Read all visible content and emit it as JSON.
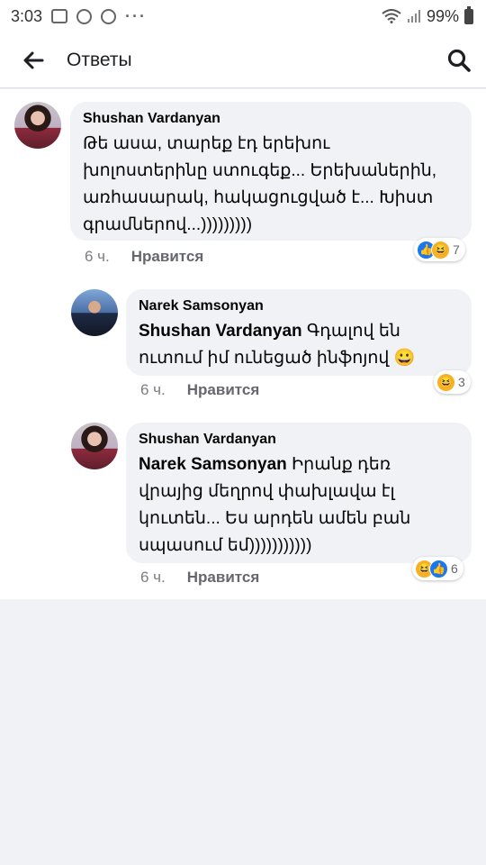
{
  "status_bar": {
    "time": "3:03",
    "dots": "···",
    "battery": "99%"
  },
  "header": {
    "title": "Ответы"
  },
  "comments": [
    {
      "author": "Shushan Vardanyan",
      "mention": "",
      "text": "Թե ասա, տարեք էդ երեխու խոլոստերինը ստուգեք... Երեխաներին, առհասարակ, հակացուցված է... Խիստ գրամներով...)))))))))",
      "time": "6 ч.",
      "like": "Нравится",
      "reaction_count": "7",
      "reaction_icons": [
        "like-icon",
        "haha-icon"
      ]
    },
    {
      "author": "Narek Samsonyan",
      "mention": "Shushan Vardanyan",
      "text": "Գդալով են ուտում իմ ունեցած ինֆոյով 😀",
      "time": "6 ч.",
      "like": "Нравится",
      "reaction_count": "3",
      "reaction_icons": [
        "haha-icon"
      ]
    },
    {
      "author": "Shushan Vardanyan",
      "mention": "Narek Samsonyan",
      "text": "Իրանք դեռ վրայից մեղրով փախլավա էլ կուտեն... Ես արդեն ամեն բան սպասում եմ)))))))))))",
      "time": "6 ч.",
      "like": "Нравится",
      "reaction_count": "6",
      "reaction_icons": [
        "haha-icon",
        "like-icon"
      ]
    }
  ],
  "colors": {
    "bubble": "#f0f2f5",
    "like": "#1877f2",
    "haha": "#f7b125",
    "meta": "#65676b"
  }
}
